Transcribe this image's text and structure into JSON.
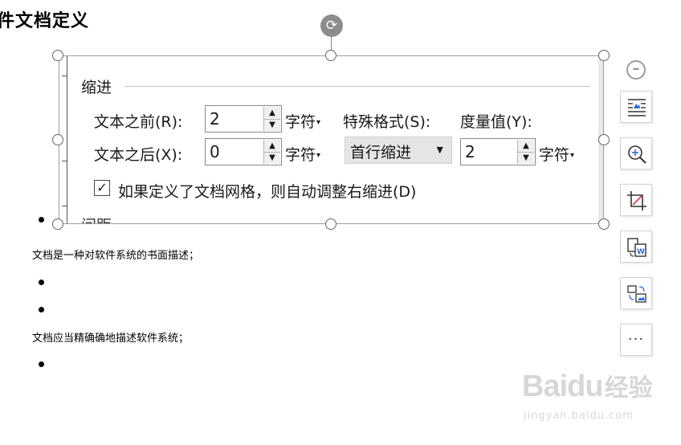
{
  "doc": {
    "heading": "件文档定义",
    "paragraphs": [
      "文档是一种对软件系统的书面描述；",
      "文档应当精确确地描述软件系统；"
    ]
  },
  "picture": {
    "top_cut_text": "▪ ▪    ▪  ▪ ▪ ▪ ▪ ▪ ▪ ▪ ▪ ▪ ▪",
    "group_title": "缩进",
    "text_before_label": "文本之前(R):",
    "text_before_value": "2",
    "text_after_label": "文本之后(X):",
    "text_after_value": "0",
    "unit": "字符",
    "special_format_label": "特殊格式(S):",
    "special_format_value": "首行缩进",
    "measure_label": "度量值(Y):",
    "measure_value": "2",
    "checkbox_label": "如果定义了文档网格，则自动调整右缩进(D)",
    "bottom_cut_text": "间距"
  },
  "watermark": {
    "brand": "Bai",
    "brand2": "du",
    "cn": "经验",
    "url": "jingyan.baidu.com"
  },
  "icons": {
    "rotate": "rotate-icon",
    "collapse": "minus-circle-icon",
    "layout": "wrap-text-icon",
    "zoom": "zoom-in-icon",
    "crop": "crop-icon",
    "convert": "convert-doc-icon",
    "replace": "replace-image-icon",
    "more": "more-icon"
  },
  "colors": {
    "handle_border": "#666666",
    "rotate_bg": "#8c8c8c",
    "combo_bg": "#e5e5e5"
  }
}
